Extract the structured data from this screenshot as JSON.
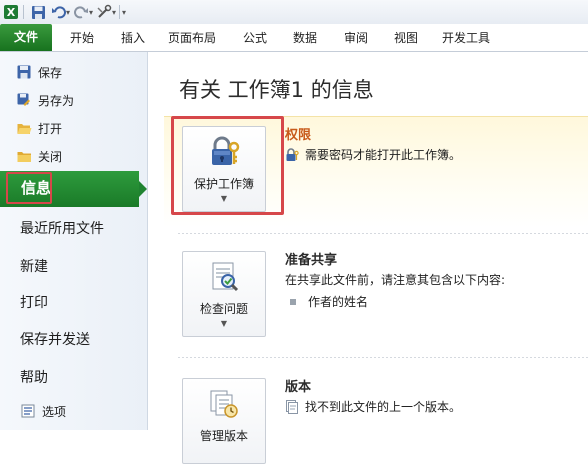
{
  "ribbon": {
    "tabs": [
      "文件",
      "开始",
      "插入",
      "页面布局",
      "公式",
      "数据",
      "审阅",
      "视图",
      "开发工具"
    ]
  },
  "nav": {
    "save": "保存",
    "save_as": "另存为",
    "open": "打开",
    "close": "关闭",
    "info": "信息",
    "recent": "最近所用文件",
    "new": "新建",
    "print": "打印",
    "save_send": "保存并发送",
    "help": "帮助",
    "options": "选项"
  },
  "main": {
    "title": "有关 工作簿1 的信息",
    "permissions": {
      "button_label": "保护工作簿",
      "heading": "权限",
      "line1": "需要密码才能打开此工作簿。"
    },
    "prepare": {
      "button_label": "检查问题",
      "heading": "准备共享",
      "line1": "在共享此文件前，请注意其包含以下内容:",
      "bullet1": "作者的姓名"
    },
    "versions": {
      "button_label": "管理版本",
      "heading": "版本",
      "line1": "找不到此文件的上一个版本。"
    }
  },
  "colors": {
    "file_tab": "#1f8330",
    "highlight": "#d6474a",
    "permissions_heading": "#c85a1a"
  }
}
